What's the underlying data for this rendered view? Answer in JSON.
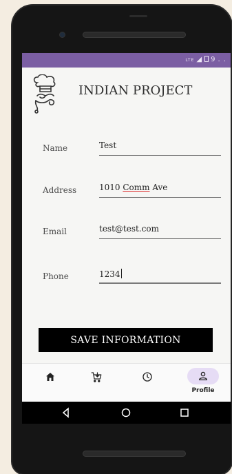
{
  "status_bar": {
    "network": "LTE",
    "signal": "◢",
    "battery": "9",
    "dots": ". ."
  },
  "app": {
    "title": "INDIAN PROJECT",
    "logo_icon": "chef-hat-icon"
  },
  "form": {
    "fields": [
      {
        "label": "Name",
        "value": "Test"
      },
      {
        "label": "Address",
        "value_prefix": "1010 ",
        "value_underlined": "Comm",
        "value_suffix": " Ave"
      },
      {
        "label": "Email",
        "value": "test@test.com"
      },
      {
        "label": "Phone",
        "value": "1234"
      }
    ],
    "save_label": "SAVE INFORMATION"
  },
  "bottom_nav": {
    "items": [
      {
        "icon": "home-icon",
        "label": ""
      },
      {
        "icon": "cart-icon",
        "label": ""
      },
      {
        "icon": "clock-icon",
        "label": ""
      },
      {
        "icon": "profile-icon",
        "label": "Profile",
        "active": true
      }
    ]
  },
  "colors": {
    "status_bar": "#7b5ea3",
    "active_pill": "#e6dcf5",
    "save_button": "#000000"
  }
}
